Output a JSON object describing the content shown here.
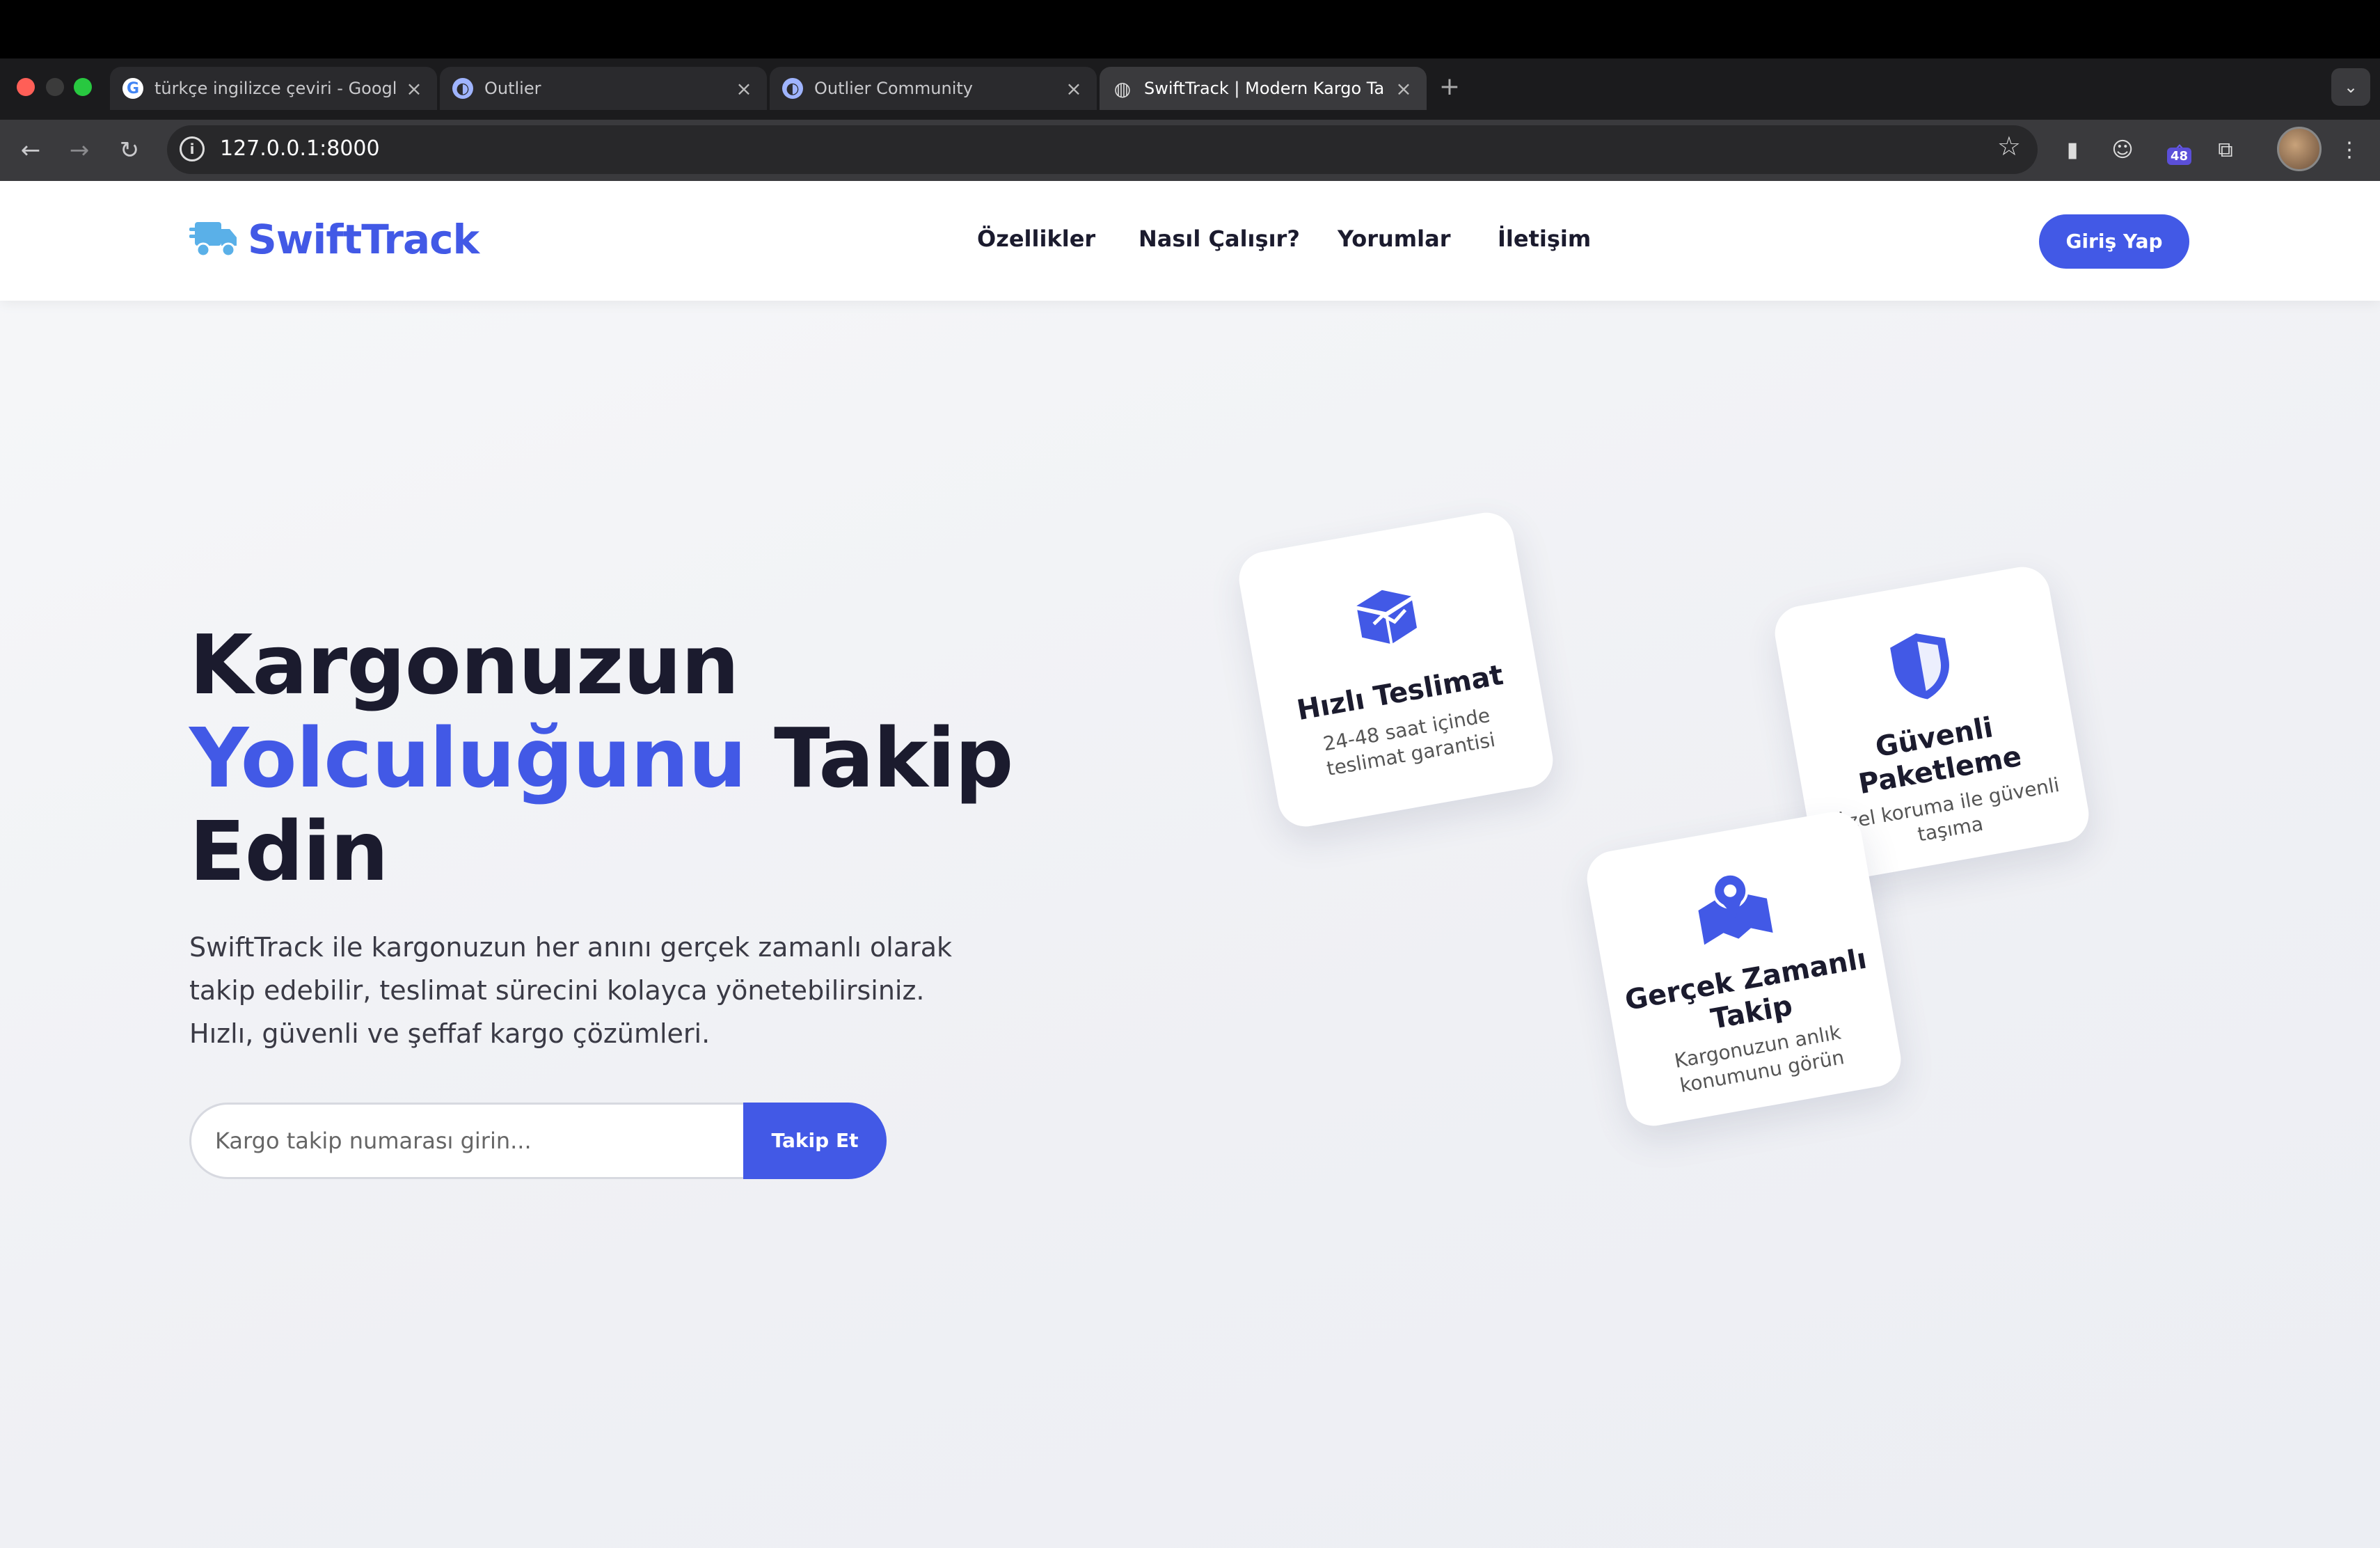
{
  "browser": {
    "tabs": [
      {
        "title": "türkçe ingilizce çeviri - Googl",
        "icon": "google-icon"
      },
      {
        "title": "Outlier",
        "icon": "outlier-icon"
      },
      {
        "title": "Outlier Community",
        "icon": "outlier-community-icon"
      },
      {
        "title": "SwiftTrack | Modern Kargo Ta",
        "icon": "globe-icon",
        "active": true
      }
    ],
    "url": "127.0.0.1:8000",
    "extension_badge": "48"
  },
  "nav": {
    "logo_text": "SwiftTrack",
    "links": [
      "Özellikler",
      "Nasıl Çalışır?",
      "Yorumlar",
      "İletişim"
    ],
    "login_label": "Giriş Yap"
  },
  "hero": {
    "title_line1": "Kargonuzun",
    "title_accent": "Yolculuğunu",
    "title_line2_rest": " Takip",
    "title_line3": "Edin",
    "subtitle": "SwiftTrack ile kargonuzun her anını gerçek zamanlı olarak takip edebilir, teslimat sürecini kolayca yönetebilirsiniz. Hızlı, güvenli ve şeffaf kargo çözümleri.",
    "track_placeholder": "Kargo takip numarası girin...",
    "track_button": "Takip Et"
  },
  "cards": [
    {
      "title": "Hızlı Teslimat",
      "desc": "24-48 saat içinde teslimat garantisi",
      "icon": "box-icon"
    },
    {
      "title": "Güvenli Paketleme",
      "desc": "Özel koruma ile güvenli taşıma",
      "icon": "shield-icon"
    },
    {
      "title": "Gerçek Zamanlı Takip",
      "desc": "Kargonuzun anlık konumunu görün",
      "icon": "map-pin-icon"
    }
  ],
  "colors": {
    "accent": "#4259e6",
    "text_dark": "#1b1b2e",
    "logo_light": "#5ab0e8"
  }
}
